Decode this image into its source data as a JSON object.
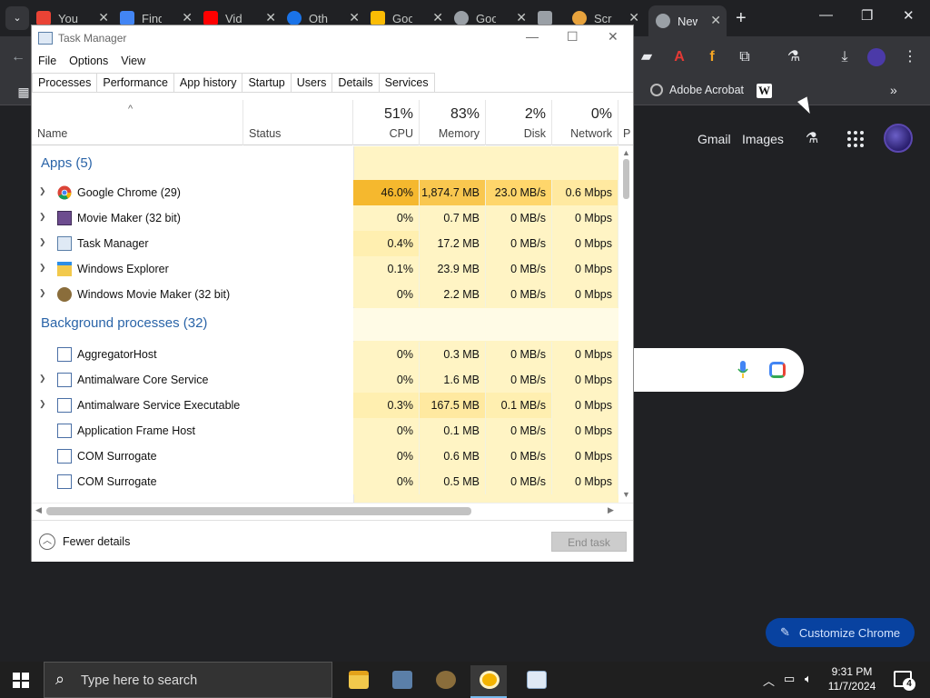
{
  "chrome": {
    "tabs": [
      {
        "label": "You",
        "fav_color": "#ea4335"
      },
      {
        "label": "Find",
        "fav_color": "#4285f4"
      },
      {
        "label": "Vid",
        "fav_color": "#ff0000"
      },
      {
        "label": "Oth",
        "fav_color": "#1a73e8"
      },
      {
        "label": "Goo",
        "fav_color": "#fbbc04"
      },
      {
        "label": "Goo",
        "fav_color": "#9aa0a6"
      },
      {
        "label": "",
        "fav_color": "#9aa0a6"
      },
      {
        "label": "Scr",
        "fav_color": "#e8a33d"
      },
      {
        "label": "New",
        "fav_color": "#9aa0a6"
      }
    ],
    "bookmark_acrobat": "Adobe Acrobat",
    "bookmark_wiki": "W",
    "gmail_link": "Gmail",
    "images_link": "Images",
    "customize_label": "Customize Chrome",
    "accent_color": "#0842a0"
  },
  "taskmanager": {
    "title": "Task Manager",
    "menu": [
      "File",
      "Options",
      "View"
    ],
    "tabs": [
      "Processes",
      "Performance",
      "App history",
      "Startup",
      "Users",
      "Details",
      "Services"
    ],
    "headers": {
      "name": "Name",
      "status": "Status",
      "cpu_pct": "51%",
      "cpu": "CPU",
      "mem_pct": "83%",
      "mem": "Memory",
      "disk_pct": "2%",
      "disk": "Disk",
      "net_pct": "0%",
      "net": "Network",
      "next": "P"
    },
    "apps_group": "Apps (5)",
    "apps": [
      {
        "name": "Google Chrome (29)",
        "cpu": "46.0%",
        "mem": "1,874.7 MB",
        "disk": "23.0 MB/s",
        "net": "0.6 Mbps"
      },
      {
        "name": "Movie Maker (32 bit)",
        "cpu": "0%",
        "mem": "0.7 MB",
        "disk": "0 MB/s",
        "net": "0 Mbps"
      },
      {
        "name": "Task Manager",
        "cpu": "0.4%",
        "mem": "17.2 MB",
        "disk": "0 MB/s",
        "net": "0 Mbps"
      },
      {
        "name": "Windows Explorer",
        "cpu": "0.1%",
        "mem": "23.9 MB",
        "disk": "0 MB/s",
        "net": "0 Mbps"
      },
      {
        "name": "Windows Movie Maker (32 bit)",
        "cpu": "0%",
        "mem": "2.2 MB",
        "disk": "0 MB/s",
        "net": "0 Mbps"
      }
    ],
    "bg_group": "Background processes (32)",
    "background": [
      {
        "name": "AggregatorHost",
        "cpu": "0%",
        "mem": "0.3 MB",
        "disk": "0 MB/s",
        "net": "0 Mbps"
      },
      {
        "name": "Antimalware Core Service",
        "cpu": "0%",
        "mem": "1.6 MB",
        "disk": "0 MB/s",
        "net": "0 Mbps"
      },
      {
        "name": "Antimalware Service Executable",
        "cpu": "0.3%",
        "mem": "167.5 MB",
        "disk": "0.1 MB/s",
        "net": "0 Mbps"
      },
      {
        "name": "Application Frame Host",
        "cpu": "0%",
        "mem": "0.1 MB",
        "disk": "0 MB/s",
        "net": "0 Mbps"
      },
      {
        "name": "COM Surrogate",
        "cpu": "0%",
        "mem": "0.6 MB",
        "disk": "0 MB/s",
        "net": "0 Mbps"
      },
      {
        "name": "COM Surrogate",
        "cpu": "0%",
        "mem": "0.5 MB",
        "disk": "0 MB/s",
        "net": "0 Mbps"
      }
    ],
    "fewer_details": "Fewer details",
    "end_task": "End task",
    "heat_colors": {
      "light": "#fff4c4",
      "medium": "#ffe9a0",
      "hot": "#f9c74f",
      "hot_cpu": "#f5b82e"
    }
  },
  "taskbar": {
    "search_placeholder": "Type here to search",
    "time": "9:31 PM",
    "date": "11/7/2024",
    "notifications": "4"
  }
}
